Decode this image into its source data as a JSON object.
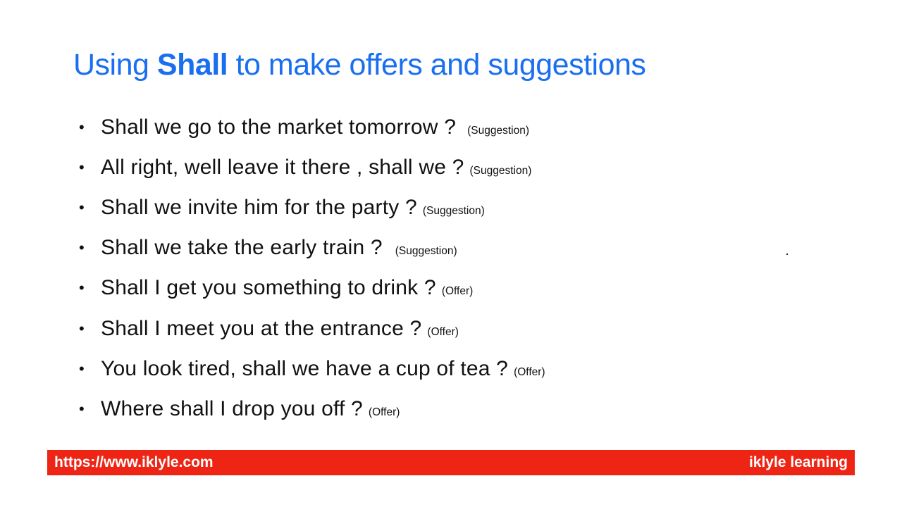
{
  "title": {
    "prefix": "Using ",
    "bold": "Shall",
    "suffix": " to make offers and suggestions"
  },
  "bullet_glyph": "•",
  "items": [
    {
      "text": "Shall we go to the market tomorrow ?",
      "tag": "(Suggestion)"
    },
    {
      "text": "All right, well leave it there , shall we ?",
      "tag": "(Suggestion)"
    },
    {
      "text": "Shall we invite him for the party ?",
      "tag": "(Suggestion)"
    },
    {
      "text": "Shall we take the early train ?",
      "tag": "(Suggestion)"
    },
    {
      "text": "Shall I get you something to drink ?",
      "tag": "(Offer)"
    },
    {
      "text": "Shall I meet you at the entrance ?",
      "tag": "(Offer)"
    },
    {
      "text": "You look tired, shall we have a cup of tea ?",
      "tag": "(Offer)"
    },
    {
      "text": "Where shall I drop you off ?",
      "tag": "(Offer)"
    }
  ],
  "footer": {
    "url": "https://www.iklyle.com",
    "brand": "iklyle learning"
  },
  "colors": {
    "title": "#1a6ff0",
    "footer_bg": "#ee2515",
    "footer_text": "#ffffff",
    "body_text": "#111111"
  }
}
